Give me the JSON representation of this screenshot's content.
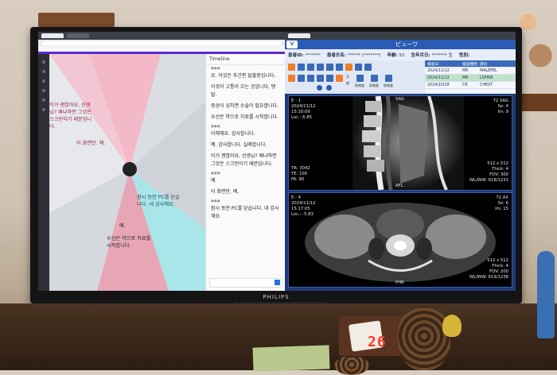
{
  "monitor": {
    "brand": "PHILIPS"
  },
  "chat": {
    "header": "Timeline",
    "messages": [
      {
        "text": "요. 이것은 추간판 탈출증입니다."
      },
      {
        "text": "이것이 고통이 오는 곳입니다. 탱탈."
      },
      {
        "text": "증상이 심하면 수술이 필요합니다."
      },
      {
        "text": "우선은 약으로 치료를 시작합니다."
      },
      {
        "text": "이해해요. 감사합니다."
      },
      {
        "text": "예. 감사합니다. 실례합니다."
      },
      {
        "text": "이거 괜찮아요, 선생님? 왜냐하면 그것은 스크린이기 때문입니다."
      },
      {
        "text": "예."
      },
      {
        "text": "이 화면만. 예."
      },
      {
        "text": "잠시 동안 PC를 닫습니다. 네 감사해요."
      }
    ]
  },
  "wheel": {
    "texts": [
      {
        "text": "이거 괜찮아요, 선생\n님? 왜냐하면 그것은\n스크린이기 때문입니\n다."
      },
      {
        "text": "이 화면만. 예."
      },
      {
        "text": "잠시 동안 PC를 닫습\n니다. 네 감사해요."
      },
      {
        "text": "예."
      },
      {
        "text": "우선은 약으로 치료를\n시작합니다."
      }
    ]
  },
  "viewer": {
    "title": "ビューワ",
    "patient": {
      "id_label": "患者ID:",
      "id_value": "*******",
      "name_label": "患者氏名:",
      "name_value": "****** (*******)",
      "age_label": "年齢:",
      "age_value": "52",
      "birth_label": "生年月日:",
      "birth_value": "******* 生",
      "sex_label": "性別:"
    },
    "studies": {
      "headers": [
        "検査日",
        "検査種別",
        "部位",
        ""
      ],
      "rows": [
        {
          "date": "2024/11/12",
          "modality": "MR",
          "part": "MALEPEL",
          "sel": false
        },
        {
          "date": "2024/11/12",
          "modality": "MR",
          "part": "LSPINE",
          "sel": true
        },
        {
          "date": "2024/10/28",
          "modality": "CR",
          "part": "CHEST",
          "sel": false
        }
      ]
    },
    "tools": [
      "文",
      "検",
      "前検査",
      "前検査",
      "前検査"
    ],
    "panel1": {
      "tl": "E - 1\n2024/11/12\n15:10:09\nLoc.: 6.85",
      "bl": "TR: 3042\nTE: 100\nFA: 90",
      "tr": "T2 SAG\nSe: 4\nIm: 9",
      "br": "512 x 512\nThick: 4\nFOV: 300\nWL/WW: 618/1231",
      "top": "SAG",
      "bottom": "AFL"
    },
    "panel2": {
      "tl": "E - 4\n2024/11/12\n15:17:05\nLoc.: -5.83",
      "tr": "T2 AX\nSe: 6\nIm: 15",
      "br": "512 x 512\nThick: 4\nFOV: 200\nWL/WW: 619/1238",
      "bottom": "PHR"
    }
  },
  "clock": {
    "digits": "26"
  }
}
